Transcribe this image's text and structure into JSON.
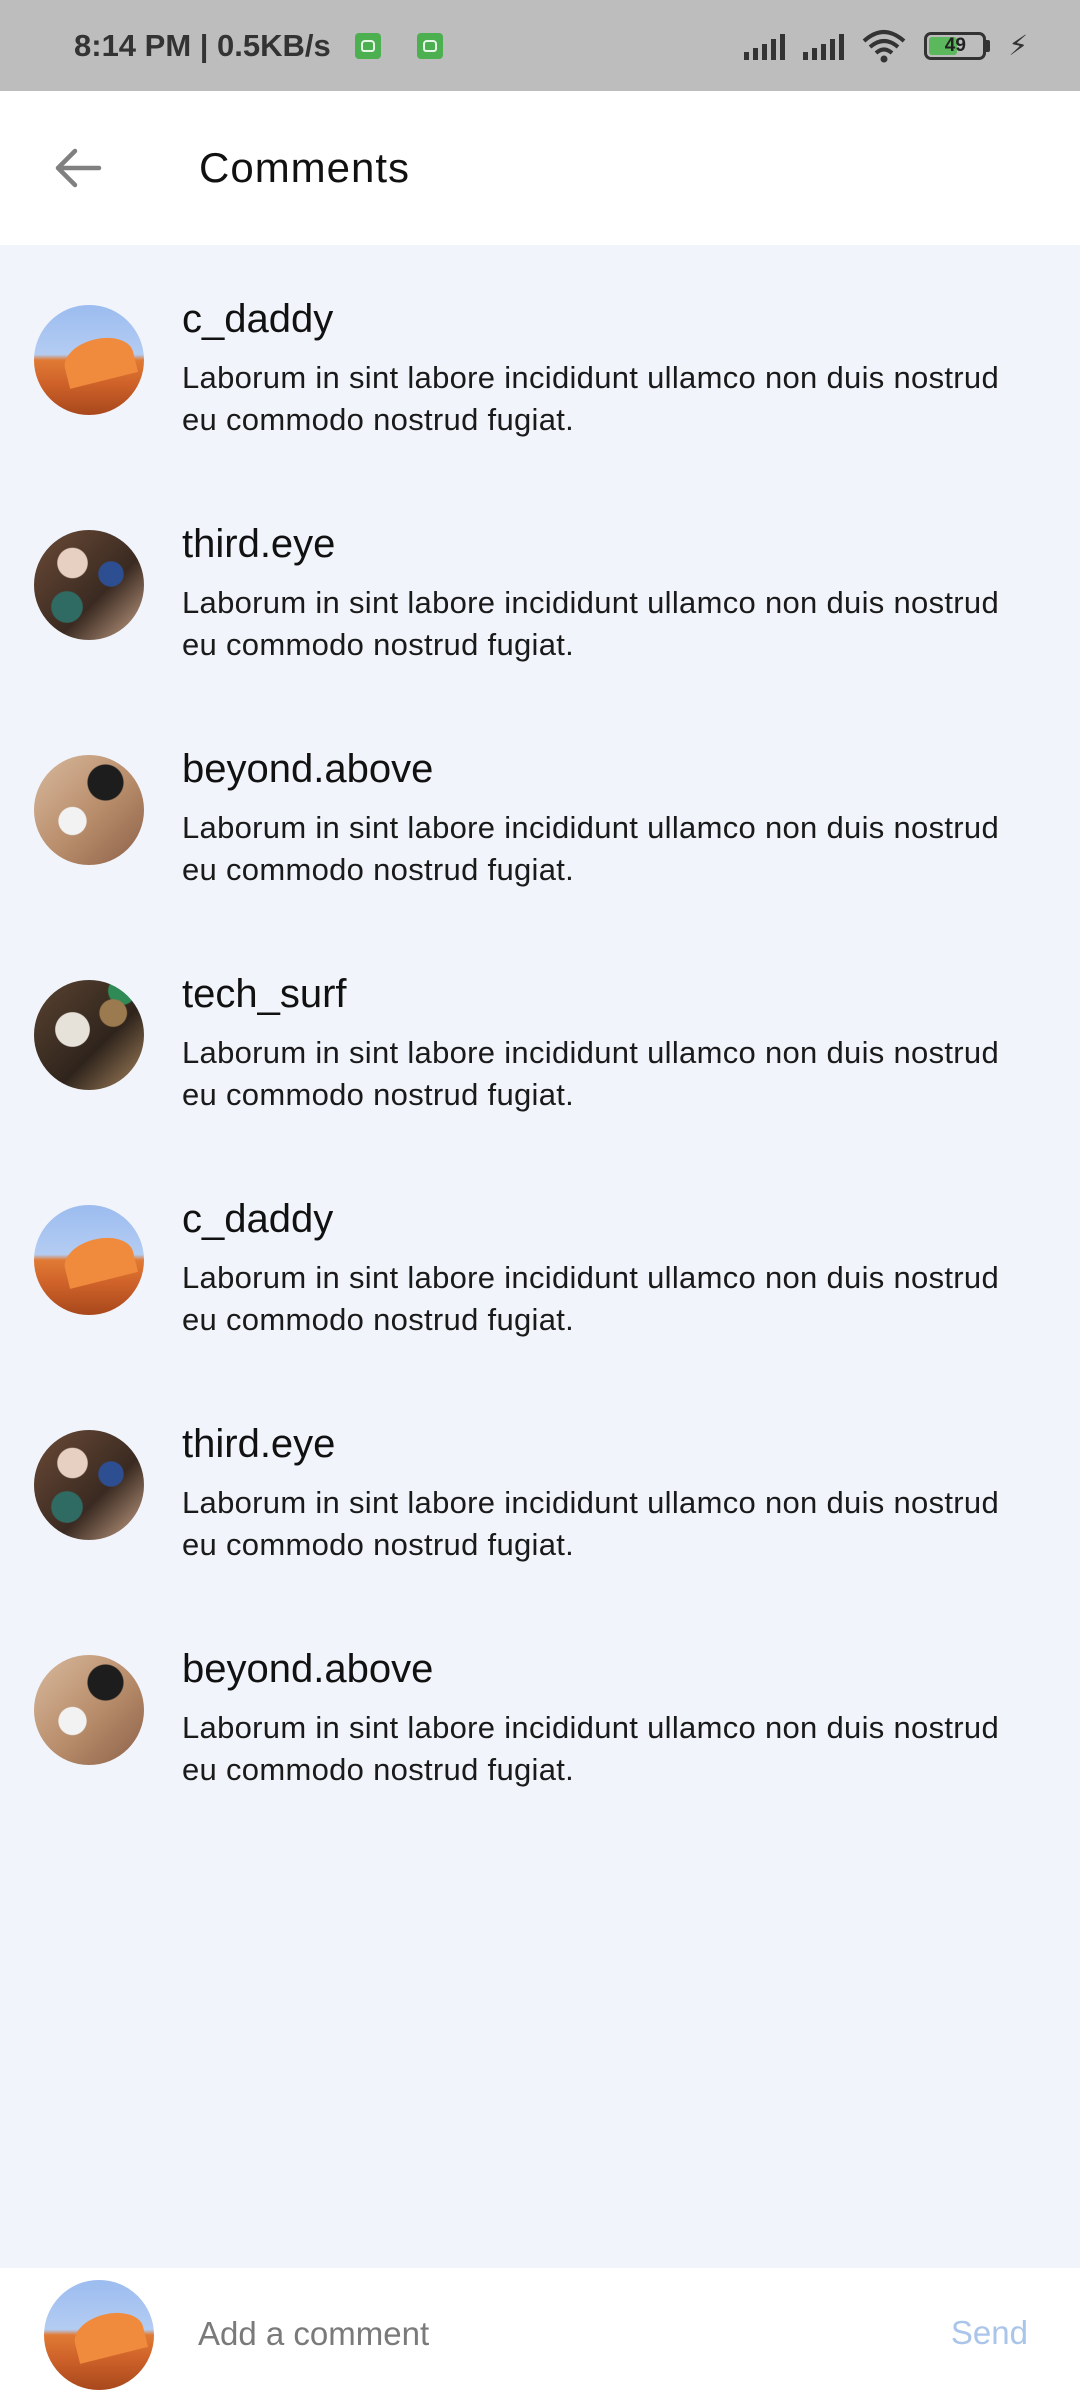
{
  "status_bar": {
    "time_speed": "8:14 PM | 0.5KB/s",
    "battery": "49",
    "battery_level": 0.49,
    "icons": [
      "android-notification-icon",
      "android-notification-icon",
      "signal-icon",
      "signal-icon",
      "wifi-icon",
      "battery-icon",
      "charging-icon"
    ]
  },
  "header": {
    "title": "Comments",
    "back_icon": "arrow-left-icon"
  },
  "comments": [
    {
      "user": "c_daddy",
      "text": "Laborum in sint labore incididunt ullamco non duis nostrud eu commodo nostrud fugiat.",
      "avatar": "desert"
    },
    {
      "user": "third.eye",
      "text": "Laborum in sint labore incididunt ullamco non duis nostrud eu commodo nostrud fugiat.",
      "avatar": "desk1"
    },
    {
      "user": "beyond.above",
      "text": "Laborum in sint labore incididunt ullamco non duis nostrud eu commodo nostrud fugiat.",
      "avatar": "desk2"
    },
    {
      "user": "tech_surf",
      "text": "Laborum in sint labore incididunt ullamco non duis nostrud eu commodo nostrud fugiat.",
      "avatar": "desk3"
    },
    {
      "user": "c_daddy",
      "text": "Laborum in sint labore incididunt ullamco non duis nostrud eu commodo nostrud fugiat.",
      "avatar": "desert"
    },
    {
      "user": "third.eye",
      "text": "Laborum in sint labore incididunt ullamco non duis nostrud eu commodo nostrud fugiat.",
      "avatar": "desk1"
    },
    {
      "user": "beyond.above",
      "text": "Laborum in sint labore incididunt ullamco non duis nostrud eu commodo nostrud fugiat.",
      "avatar": "desk2"
    }
  ],
  "composer": {
    "placeholder": "Add a comment",
    "send_label": "Send",
    "avatar": "desert"
  },
  "colors": {
    "background": "#f1f4fb",
    "header": "#ffffff",
    "status_bar": "#bdbdbd",
    "send_disabled": "#aac4ea"
  }
}
